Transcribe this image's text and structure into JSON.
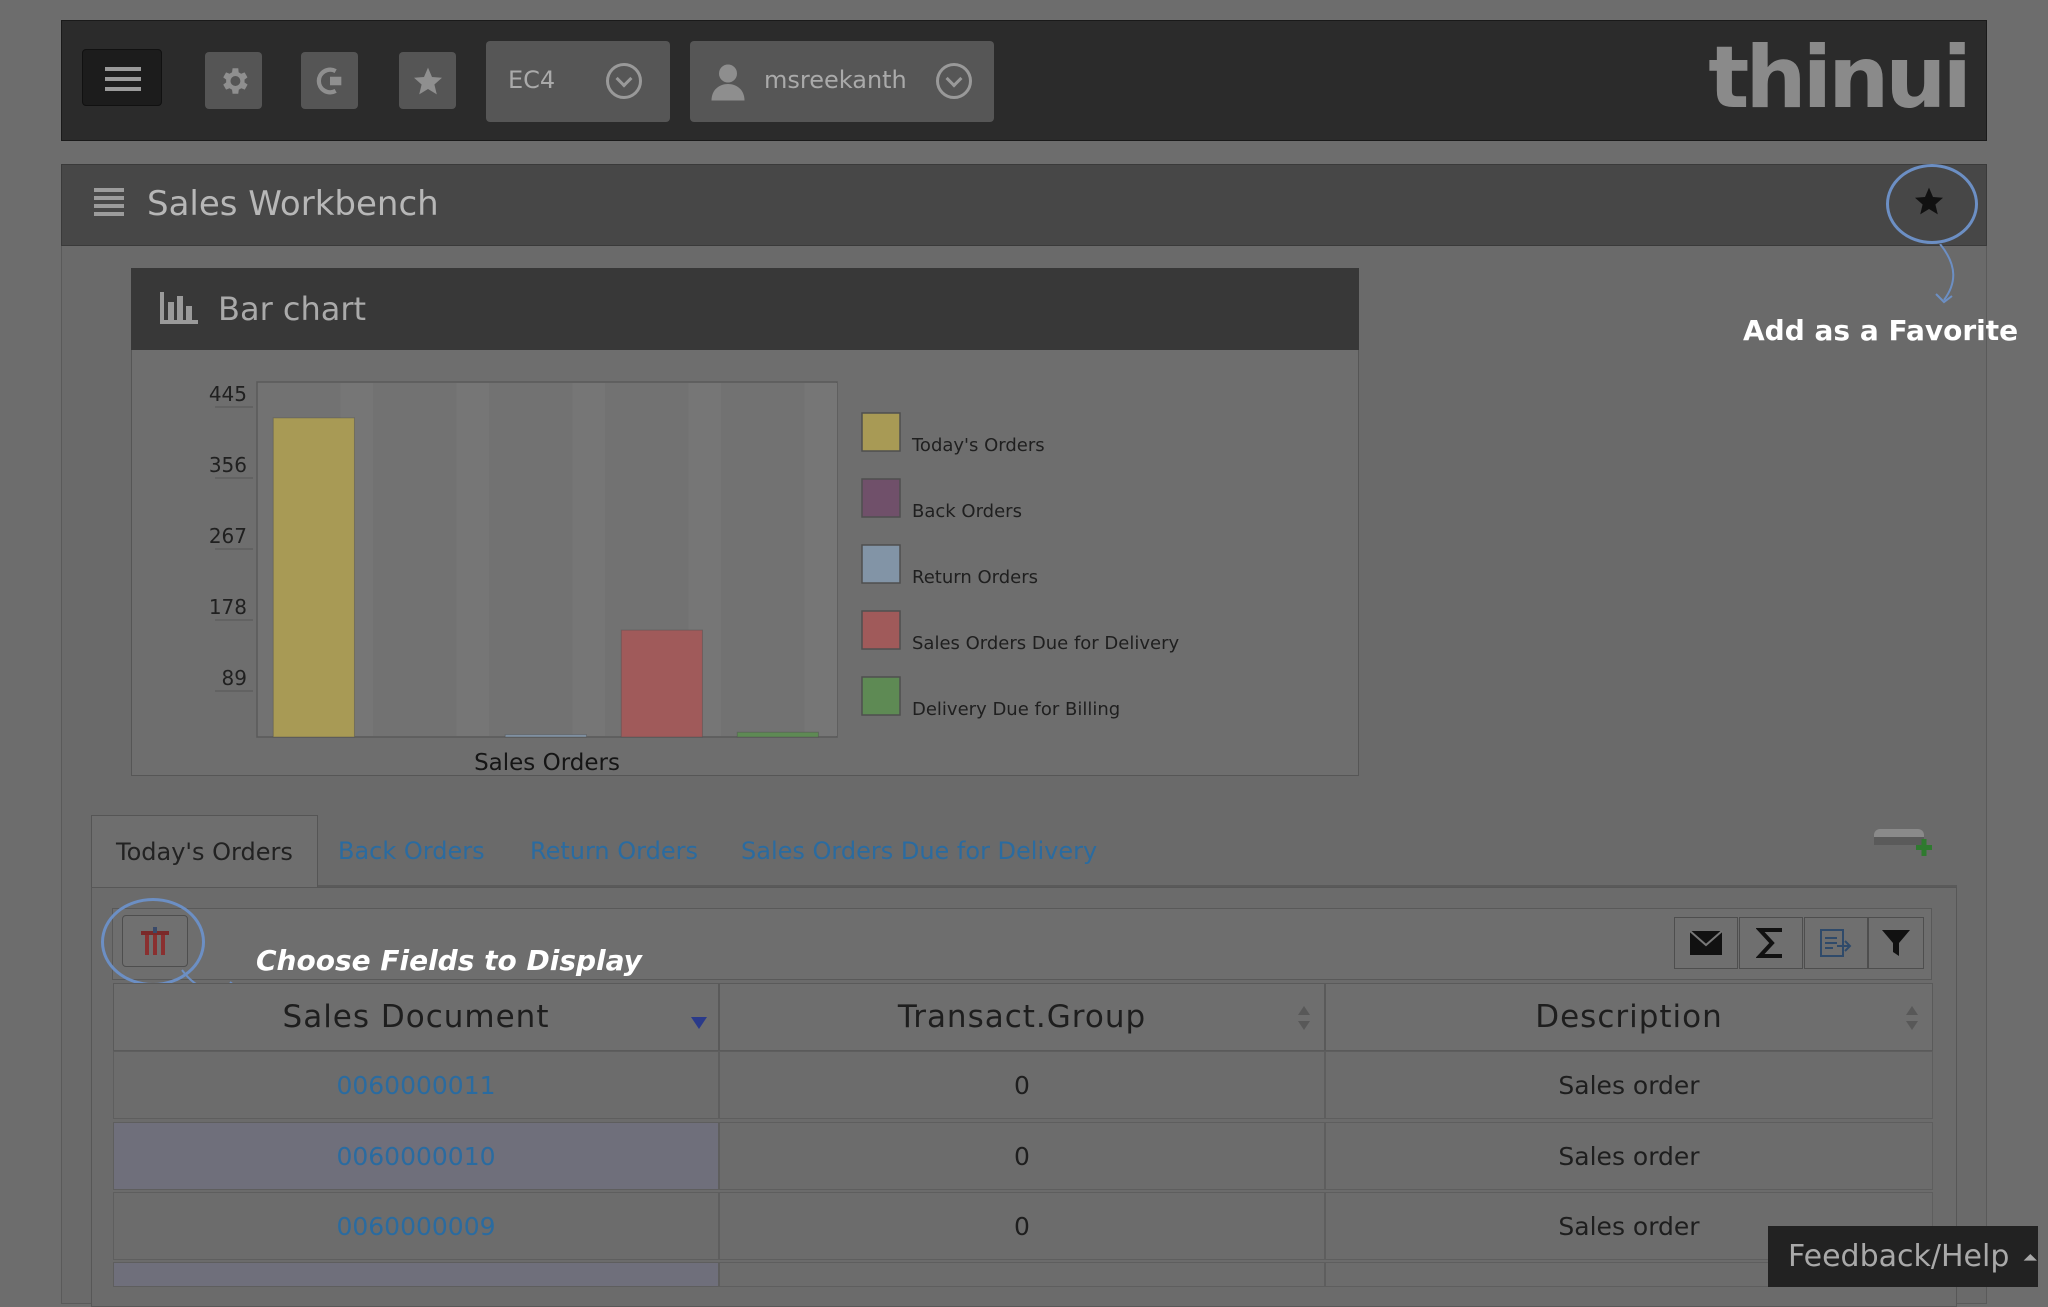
{
  "topbar": {
    "system": "EC4",
    "user": "msreekanth",
    "logo": "thinui"
  },
  "workbench": {
    "title": "Sales Workbench",
    "favorite_annotation": "Add as a Favorite"
  },
  "chart_panel": {
    "title": "Bar chart"
  },
  "chart_data": {
    "type": "bar",
    "xlabel": "Sales Orders",
    "ylabel": "",
    "ylim": [
      0,
      445
    ],
    "yticks": [
      89,
      178,
      267,
      356,
      445
    ],
    "series": [
      {
        "name": "Today's Orders",
        "value": 400,
        "color": "#a89a55"
      },
      {
        "name": "Back Orders",
        "value": 0,
        "color": "#70506a"
      },
      {
        "name": "Return Orders",
        "value": 3,
        "color": "#8294a6"
      },
      {
        "name": "Sales Orders Due for Delivery",
        "value": 134,
        "color": "#a05a5a"
      },
      {
        "name": "Delivery Due for Billing",
        "value": 6,
        "color": "#5e8a54"
      }
    ],
    "legend": "right"
  },
  "tabs": [
    {
      "label": "Today's Orders",
      "active": true
    },
    {
      "label": "Back Orders",
      "active": false
    },
    {
      "label": "Return Orders",
      "active": false
    },
    {
      "label": "Sales Orders Due for Delivery",
      "active": false
    }
  ],
  "grid": {
    "fields_annotation": "Choose Fields to Display",
    "columns": [
      "Sales Document",
      "Transact.Group",
      "Description"
    ],
    "rows": [
      {
        "doc": "0060000011",
        "group": "0",
        "desc": "Sales order"
      },
      {
        "doc": "0060000010",
        "group": "0",
        "desc": "Sales order"
      },
      {
        "doc": "0060000009",
        "group": "0",
        "desc": "Sales order"
      }
    ]
  },
  "footer": {
    "feedback": "Feedback/Help"
  }
}
